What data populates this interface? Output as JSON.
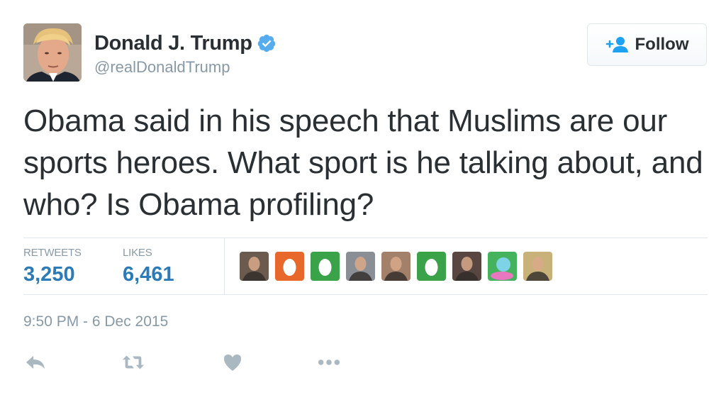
{
  "author": {
    "name": "Donald J. Trump",
    "handle": "@realDonaldTrump",
    "verified_icon": "verified-badge",
    "avatar": "author-photo"
  },
  "follow_button": {
    "label": "Follow",
    "icon": "add-person-icon"
  },
  "tweet": {
    "text": "Obama said in his speech that Muslims are our sports heroes. What sport is he talking about, and who? Is Obama profiling?"
  },
  "stats": {
    "retweets_label": "RETWEETS",
    "retweets_value": "3,250",
    "likes_label": "LIKES",
    "likes_value": "6,461"
  },
  "likers": [
    {
      "type": "photo",
      "color": "#6b5a4e"
    },
    {
      "type": "egg",
      "color": "#e8682c"
    },
    {
      "type": "egg",
      "color": "#3aa248"
    },
    {
      "type": "photo",
      "color": "#8a8f96"
    },
    {
      "type": "photo",
      "color": "#a2806a"
    },
    {
      "type": "egg",
      "color": "#3aa248"
    },
    {
      "type": "photo",
      "color": "#5a4640"
    },
    {
      "type": "cartoon",
      "color": "#45b35d"
    },
    {
      "type": "photo",
      "color": "#c9b27a"
    }
  ],
  "timestamp": "9:50 PM - 6 Dec 2015",
  "actions": {
    "reply_icon": "reply-icon",
    "retweet_icon": "retweet-icon",
    "like_icon": "heart-icon",
    "more_icon": "more-icon"
  },
  "colors": {
    "text": "#292f33",
    "secondary": "#8899a6",
    "stat_value": "#2b7bb9",
    "verified": "#55acee",
    "action_icon": "#aab8c2",
    "divider": "#e1e8ed"
  }
}
